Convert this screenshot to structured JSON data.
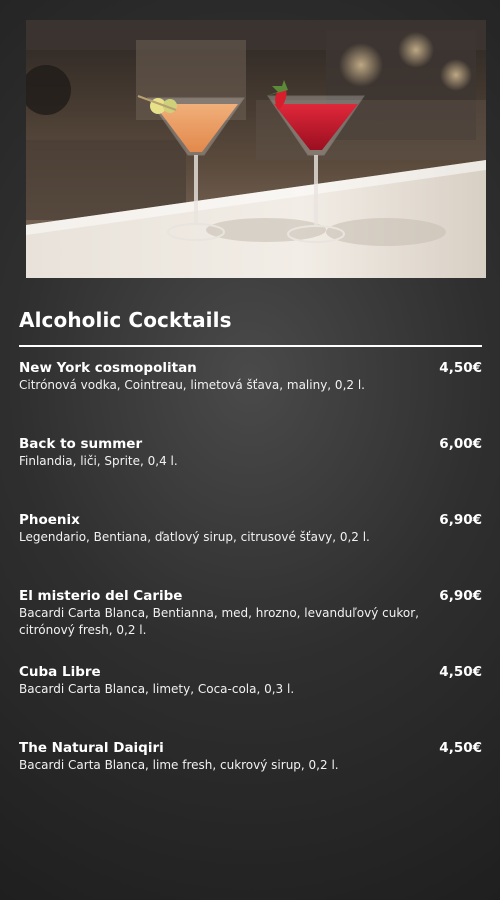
{
  "section": {
    "title": "Alcoholic Cocktails"
  },
  "hero_image": {
    "icon": "cocktail-glasses-photo"
  },
  "items": [
    {
      "name": "New York cosmopolitan",
      "description": "Citrónová vodka, Cointreau, limetová šťava, maliny, 0,2 l.",
      "price": "4,50€"
    },
    {
      "name": "Back to summer",
      "description": "Finlandia, liči, Sprite, 0,4 l.",
      "price": "6,00€"
    },
    {
      "name": "Phoenix",
      "description": "Legendario, Bentiana, ďatlový sirup, citrusové šťavy, 0,2 l.",
      "price": "6,90€"
    },
    {
      "name": "El misterio del Caribe",
      "description": "Bacardi Carta Blanca, Bentianna, med, hrozno, levanduľový cukor, citrónový fresh, 0,2 l.",
      "price": "6,90€"
    },
    {
      "name": "Cuba Libre",
      "description": "Bacardi Carta Blanca, limety, Coca-cola, 0,3 l.",
      "price": "4,50€"
    },
    {
      "name": "The Natural Daiqiri",
      "description": "Bacardi Carta Blanca, lime fresh, cukrový sirup, 0,2 l.",
      "price": "4,50€"
    }
  ]
}
